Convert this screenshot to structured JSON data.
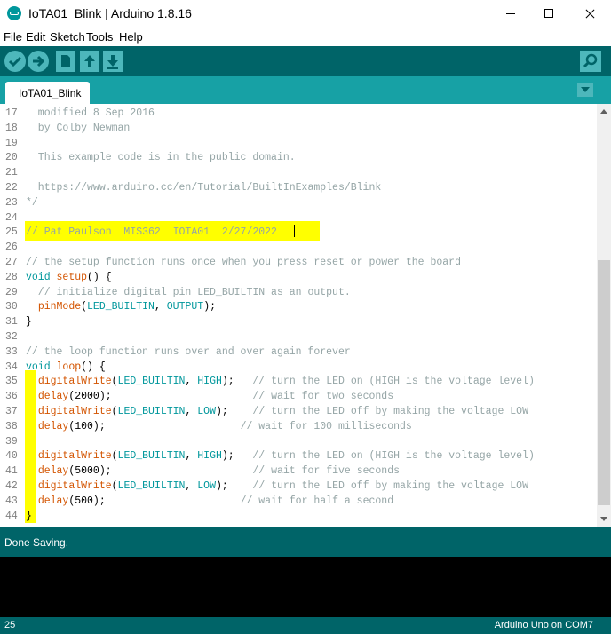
{
  "window": {
    "title": "IoTA01_Blink | Arduino 1.8.16",
    "accent": "#006468",
    "tab_accent": "#17a1a5",
    "button_color": "#4db7bb"
  },
  "menu": [
    "File",
    "Edit",
    "Sketch",
    "Tools",
    "Help"
  ],
  "toolbar": {
    "buttons": [
      "verify-icon",
      "upload-icon",
      "new-icon",
      "open-icon",
      "save-icon"
    ],
    "right_button": "serial-monitor-icon"
  },
  "tabs": [
    {
      "label": "IoTA01_Blink"
    }
  ],
  "editor": {
    "lines": [
      {
        "n": "17",
        "segs": [
          {
            "t": "  modified 8 Sep 2016",
            "c": "comment"
          }
        ]
      },
      {
        "n": "18",
        "segs": [
          {
            "t": "  by Colby Newman",
            "c": "comment"
          }
        ]
      },
      {
        "n": "19",
        "segs": []
      },
      {
        "n": "20",
        "segs": [
          {
            "t": "  This example code is in the public domain.",
            "c": "comment"
          }
        ]
      },
      {
        "n": "21",
        "segs": []
      },
      {
        "n": "22",
        "segs": [
          {
            "t": "  https://www.arduino.cc/en/Tutorial/BuiltInExamples/Blink",
            "c": "comment"
          }
        ]
      },
      {
        "n": "23",
        "segs": [
          {
            "t": "*/",
            "c": "comment"
          }
        ]
      },
      {
        "n": "24",
        "segs": []
      },
      {
        "n": "25",
        "segs": [
          {
            "t": "// Pat Paulson  MIS362  IOTA01  2/27/2022 ",
            "c": "comment"
          }
        ]
      },
      {
        "n": "26",
        "segs": []
      },
      {
        "n": "27",
        "segs": [
          {
            "t": "// the setup function runs once when you press reset or power the board",
            "c": "comment"
          }
        ]
      },
      {
        "n": "28",
        "segs": [
          {
            "t": "void",
            "c": "kw"
          },
          {
            "t": " "
          },
          {
            "t": "setup",
            "c": "fn"
          },
          {
            "t": "() {"
          }
        ]
      },
      {
        "n": "29",
        "segs": [
          {
            "t": "  // initialize digital pin LED_BUILTIN as an output.",
            "c": "comment"
          }
        ]
      },
      {
        "n": "30",
        "segs": [
          {
            "t": "  "
          },
          {
            "t": "pinMode",
            "c": "fn"
          },
          {
            "t": "("
          },
          {
            "t": "LED_BUILTIN",
            "c": "const"
          },
          {
            "t": ", "
          },
          {
            "t": "OUTPUT",
            "c": "const"
          },
          {
            "t": ");"
          }
        ]
      },
      {
        "n": "31",
        "segs": [
          {
            "t": "}"
          }
        ]
      },
      {
        "n": "32",
        "segs": []
      },
      {
        "n": "33",
        "segs": [
          {
            "t": "// the loop function runs over and over again forever",
            "c": "comment"
          }
        ]
      },
      {
        "n": "34",
        "segs": [
          {
            "t": "void",
            "c": "kw"
          },
          {
            "t": " "
          },
          {
            "t": "loop",
            "c": "fn"
          },
          {
            "t": "() {"
          }
        ]
      },
      {
        "n": "35",
        "segs": [
          {
            "t": "  "
          },
          {
            "t": "digitalWrite",
            "c": "fn"
          },
          {
            "t": "("
          },
          {
            "t": "LED_BUILTIN",
            "c": "const"
          },
          {
            "t": ", "
          },
          {
            "t": "HIGH",
            "c": "const"
          },
          {
            "t": ");   "
          },
          {
            "t": "// turn the LED on (HIGH is the voltage level)",
            "c": "comment"
          }
        ]
      },
      {
        "n": "36",
        "segs": [
          {
            "t": "  "
          },
          {
            "t": "delay",
            "c": "fn"
          },
          {
            "t": "(2000);                       "
          },
          {
            "t": "// wait for two seconds",
            "c": "comment"
          }
        ]
      },
      {
        "n": "37",
        "segs": [
          {
            "t": "  "
          },
          {
            "t": "digitalWrite",
            "c": "fn"
          },
          {
            "t": "("
          },
          {
            "t": "LED_BUILTIN",
            "c": "const"
          },
          {
            "t": ", "
          },
          {
            "t": "LOW",
            "c": "const"
          },
          {
            "t": ");    "
          },
          {
            "t": "// turn the LED off by making the voltage LOW",
            "c": "comment"
          }
        ]
      },
      {
        "n": "38",
        "segs": [
          {
            "t": "  "
          },
          {
            "t": "delay",
            "c": "fn"
          },
          {
            "t": "(100);                      "
          },
          {
            "t": "// wait for 100 milliseconds",
            "c": "comment"
          }
        ]
      },
      {
        "n": "39",
        "segs": []
      },
      {
        "n": "40",
        "segs": [
          {
            "t": "  "
          },
          {
            "t": "digitalWrite",
            "c": "fn"
          },
          {
            "t": "("
          },
          {
            "t": "LED_BUILTIN",
            "c": "const"
          },
          {
            "t": ", "
          },
          {
            "t": "HIGH",
            "c": "const"
          },
          {
            "t": ");   "
          },
          {
            "t": "// turn the LED on (HIGH is the voltage level)",
            "c": "comment"
          }
        ]
      },
      {
        "n": "41",
        "segs": [
          {
            "t": "  "
          },
          {
            "t": "delay",
            "c": "fn"
          },
          {
            "t": "(5000);                       "
          },
          {
            "t": "// wait for five seconds",
            "c": "comment"
          }
        ]
      },
      {
        "n": "42",
        "segs": [
          {
            "t": "  "
          },
          {
            "t": "digitalWrite",
            "c": "fn"
          },
          {
            "t": "("
          },
          {
            "t": "LED_BUILTIN",
            "c": "const"
          },
          {
            "t": ", "
          },
          {
            "t": "LOW",
            "c": "const"
          },
          {
            "t": ");    "
          },
          {
            "t": "// turn the LED off by making the voltage LOW",
            "c": "comment"
          }
        ]
      },
      {
        "n": "43",
        "segs": [
          {
            "t": "  "
          },
          {
            "t": "delay",
            "c": "fn"
          },
          {
            "t": "(500);                      "
          },
          {
            "t": "// wait for half a second",
            "c": "comment"
          }
        ]
      },
      {
        "n": "44",
        "segs": [
          {
            "t": "}"
          }
        ]
      }
    ],
    "colors": {
      "comment": "#95a5a6",
      "kw": "#00979c",
      "fn": "#d35400",
      "const": "#00979c",
      "highlight": "#ffff00"
    }
  },
  "status": {
    "message": "Done Saving."
  },
  "footer": {
    "line": "25",
    "board": "Arduino Uno on COM7"
  }
}
